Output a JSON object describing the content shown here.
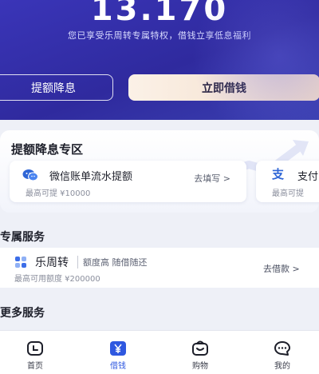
{
  "hero": {
    "amount": "13.170",
    "subtitle": "您已享受乐周转专属特权，借钱立享低息福利",
    "btn_limit": "提额降息",
    "btn_borrow": "立即借钱"
  },
  "zone": {
    "title": "提额降息专区",
    "cards": [
      {
        "icon": "wechat-icon",
        "name": "微信账单流水提额",
        "desc": "最高可提  ¥10000",
        "action": "去填写 >"
      },
      {
        "icon": "alipay-icon",
        "name": "支付",
        "desc": "最高可提"
      }
    ]
  },
  "exclusive": {
    "title": "专属服务",
    "product": {
      "icon": "lezhouzhuan-icon",
      "name": "乐周转",
      "tag": "额度高  随借随还",
      "desc": "最高可用额度  ¥200000",
      "action": "去借款 >"
    }
  },
  "more": {
    "title": "更多服务"
  },
  "tabbar": {
    "items": [
      {
        "label": "首页",
        "icon": "home-icon"
      },
      {
        "label": "借钱",
        "icon": "yen-icon",
        "active": true
      },
      {
        "label": "购物",
        "icon": "shopping-bag-icon"
      },
      {
        "label": "我的",
        "icon": "chat-bubble-icon"
      }
    ]
  },
  "colors": {
    "hero": "#3a35b8",
    "accent": "#2f58e0",
    "borrow_button": "#f3dcc8"
  }
}
